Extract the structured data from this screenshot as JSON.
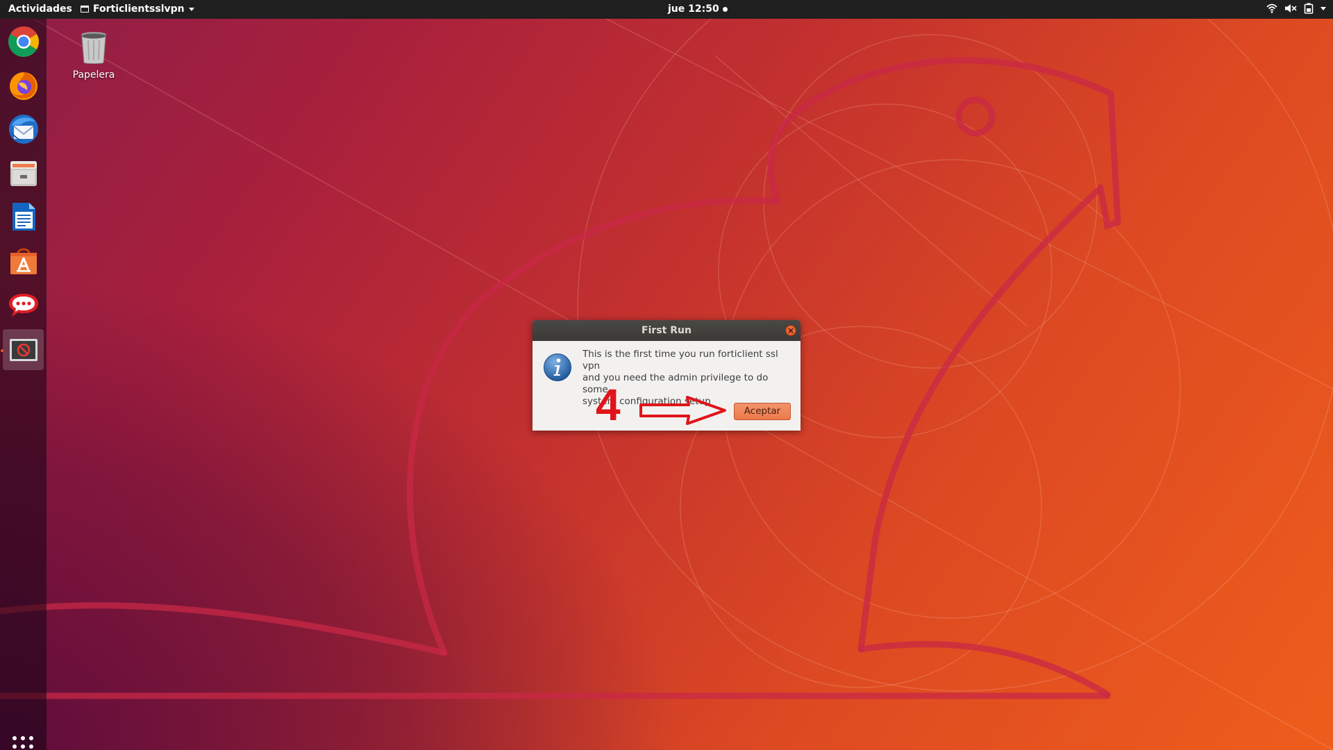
{
  "topbar": {
    "activities_label": "Actividades",
    "app_menu_label": "Forticlientsslvpn",
    "clock": "jue 12:50",
    "tray_icons": [
      "wifi-icon",
      "speaker-muted-icon",
      "battery-icon",
      "chevron-down-icon"
    ]
  },
  "dock": {
    "items": [
      {
        "name": "chrome-icon"
      },
      {
        "name": "firefox-icon"
      },
      {
        "name": "thunderbird-icon"
      },
      {
        "name": "files-icon"
      },
      {
        "name": "writer-icon"
      },
      {
        "name": "software-icon"
      },
      {
        "name": "rocketchat-icon"
      },
      {
        "name": "forticlient-icon",
        "active": true
      }
    ],
    "show_apps_icon": "apps-grid-icon"
  },
  "desktop": {
    "trash_label": "Papelera"
  },
  "dialog": {
    "title": "First Run",
    "message": "This is the first time you run forticlient ssl vpn\n and you need the admin privilege to do some\nsystem configuration setup",
    "ok_label": "Aceptar",
    "icon": "info-icon"
  },
  "annotation": {
    "step_number": "4"
  },
  "colors": {
    "accent": "#e95420",
    "annotation": "#e0141a",
    "topbar": "#1f1f1f"
  }
}
